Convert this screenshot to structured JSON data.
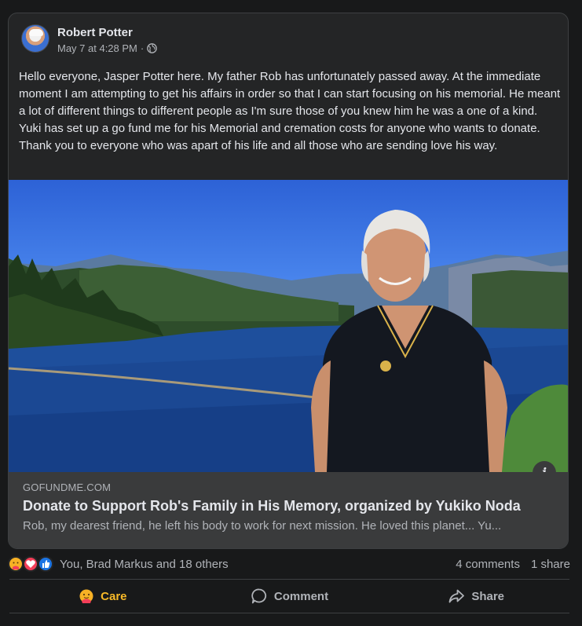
{
  "post": {
    "author": "Robert Potter",
    "timestamp": "May 7 at 4:28 PM",
    "separator": "·",
    "privacy_icon": "globe-icon",
    "body": "Hello everyone, Jasper Potter here. My father Rob has unfortunately passed away. At the immediate moment I am attempting to get his affairs in order so that I can start focusing on his memorial. He meant a lot of different things to different people as I'm sure those of you knew him he was a one of a kind. Yuki has set up a go fund me for his Memorial and cremation costs for anyone who wants to donate. Thank you to everyone who was apart of his life and all those who are sending love his way."
  },
  "link_preview": {
    "domain": "GOFUNDME.COM",
    "title": "Donate to Support Rob's Family in His Memory, organized by Yukiko Noda",
    "description": "Rob, my dearest friend, he left his body to work for next mission. He loved this planet... Yu...",
    "info_label": "i"
  },
  "engagement": {
    "reactions": [
      "care",
      "love",
      "like"
    ],
    "reaction_names": "You, Brad Markus and 18 others",
    "comments": "4 comments",
    "shares": "1 share"
  },
  "actions": {
    "care_label": "Care",
    "comment_label": "Comment",
    "share_label": "Share"
  },
  "colors": {
    "background": "#18191a",
    "card": "#242526",
    "care_accent": "#f7b928",
    "love": "#f33e58",
    "like": "#1b74e4"
  }
}
